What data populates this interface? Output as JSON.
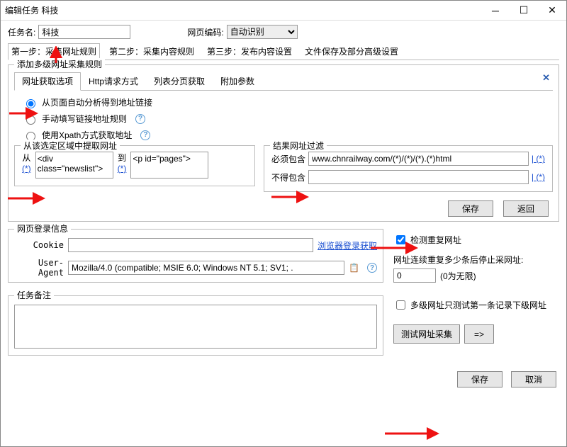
{
  "window": {
    "title": "编辑任务 科技"
  },
  "task": {
    "name_label": "任务名:",
    "name_value": "科技",
    "encoding_label": "网页编码:",
    "encoding_value": "自动识别"
  },
  "step_tabs": [
    "第一步：采集网址规则",
    "第二步：采集内容规则",
    "第三步：发布内容设置",
    "文件保存及部分高级设置"
  ],
  "multi_panel": {
    "title": "添加多级网址采集规则",
    "inner_tabs": [
      "网址获取选项",
      "Http请求方式",
      "列表分页获取",
      "附加参数"
    ],
    "close": "✕",
    "radios": {
      "auto": "从页面自动分析得到地址链接",
      "manual": "手动填写链接地址规则",
      "xpath": "使用Xpath方式获取地址"
    },
    "region": {
      "title": "从该选定区域中提取网址",
      "from_label": "从",
      "from_star": "(*)",
      "from_value": "<div class=\"newslist\">",
      "to_label": "到",
      "to_star": "(*)",
      "to_value": "<p id=\"pages\">"
    },
    "filter": {
      "title": "结果网址过滤",
      "must_label": "必须包含",
      "must_value": "www.chnrailway.com/(*)/(*)/(*).(*)html",
      "must_link": "| (*)",
      "not_label": "不得包含",
      "not_value": "",
      "not_link": "| (*)"
    },
    "buttons": {
      "save": "保存",
      "back": "返回"
    }
  },
  "login_panel": {
    "title": "网页登录信息",
    "cookie_label": "Cookie",
    "cookie_value": "",
    "cookie_link": "浏览器登录获取",
    "ua_label": "User-Agent",
    "ua_value": "Mozilla/4.0 (compatible; MSIE 6.0; Windows NT 5.1; SV1; ."
  },
  "right_opts": {
    "dup_label": "检测重复网址",
    "repeat_label": "网址连续重复多少条后停止采网址:",
    "repeat_value": "0",
    "repeat_suffix": "(0为无限)"
  },
  "remark_panel": {
    "title": "任务备注",
    "value": ""
  },
  "right_bottom": {
    "test_only_first": "多级网址只测试第一条记录下级网址",
    "test_button": "测试网址采集",
    "arrow_btn": "=>"
  },
  "bottom": {
    "save": "保存",
    "cancel": "取消"
  }
}
